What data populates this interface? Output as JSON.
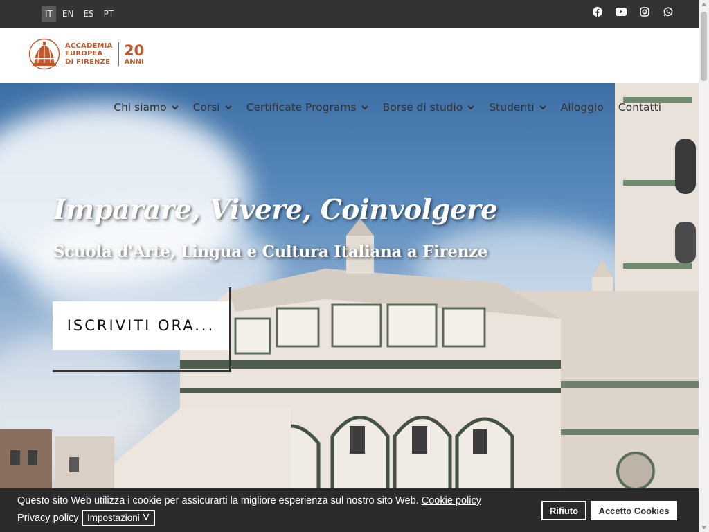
{
  "topbar": {
    "languages": [
      {
        "code": "IT",
        "active": true
      },
      {
        "code": "EN",
        "active": false
      },
      {
        "code": "ES",
        "active": false
      },
      {
        "code": "PT",
        "active": false
      }
    ],
    "socials": [
      "facebook-icon",
      "youtube-icon",
      "instagram-icon",
      "whatsapp-icon"
    ]
  },
  "logo": {
    "line1": "ACCADEMIA",
    "line2": "EUROPEA",
    "line3": "DI FIRENZE",
    "years": "20",
    "anni": "ANNI",
    "color": "#c4582a"
  },
  "nav": {
    "items": [
      {
        "label": "Chi siamo",
        "has_dropdown": true
      },
      {
        "label": "Corsi",
        "has_dropdown": true
      },
      {
        "label": "Certificate Programs",
        "has_dropdown": true
      },
      {
        "label": "Borse di studio",
        "has_dropdown": true
      },
      {
        "label": "Studenti",
        "has_dropdown": true
      },
      {
        "label": "Alloggio",
        "has_dropdown": false
      },
      {
        "label": "Contatti",
        "has_dropdown": false
      }
    ]
  },
  "hero": {
    "title": "Imparare, Vivere, Coinvolgere",
    "subtitle": "Scuola d'Arte, Lingua e Cultura Italiana a Firenze",
    "cta_label": "ISCRIVITI ORA..."
  },
  "cookie": {
    "text": "Questo sito Web utilizza i cookie per assicurarti la migliore esperienza sul nostro sito Web.",
    "policy_link": "Cookie policy",
    "privacy_link": "Privacy policy",
    "settings_label": "Impostazioni",
    "reject_label": "Rifiuto",
    "accept_label": "Accetto Cookies"
  }
}
